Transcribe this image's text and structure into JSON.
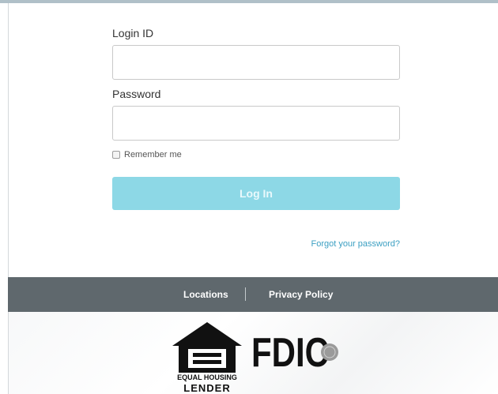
{
  "form": {
    "login_label": "Login ID",
    "login_value": "",
    "password_label": "Password",
    "password_value": "",
    "remember_label": "Remember me",
    "remember_checked": false,
    "login_button": "Log In",
    "forgot_link": "Forgot your password?"
  },
  "footer": {
    "links": [
      "Locations",
      "Privacy Policy"
    ]
  },
  "logos": {
    "equal_housing_line1": "EQUAL HOUSING",
    "equal_housing_line2": "LENDER",
    "fdic": "FDIC"
  },
  "colors": {
    "button": "#8dd8e6",
    "link": "#3b9fc2",
    "footer": "#5f686d"
  },
  "icons": [
    "equal-housing-lender-icon",
    "fdic-seal-icon"
  ]
}
